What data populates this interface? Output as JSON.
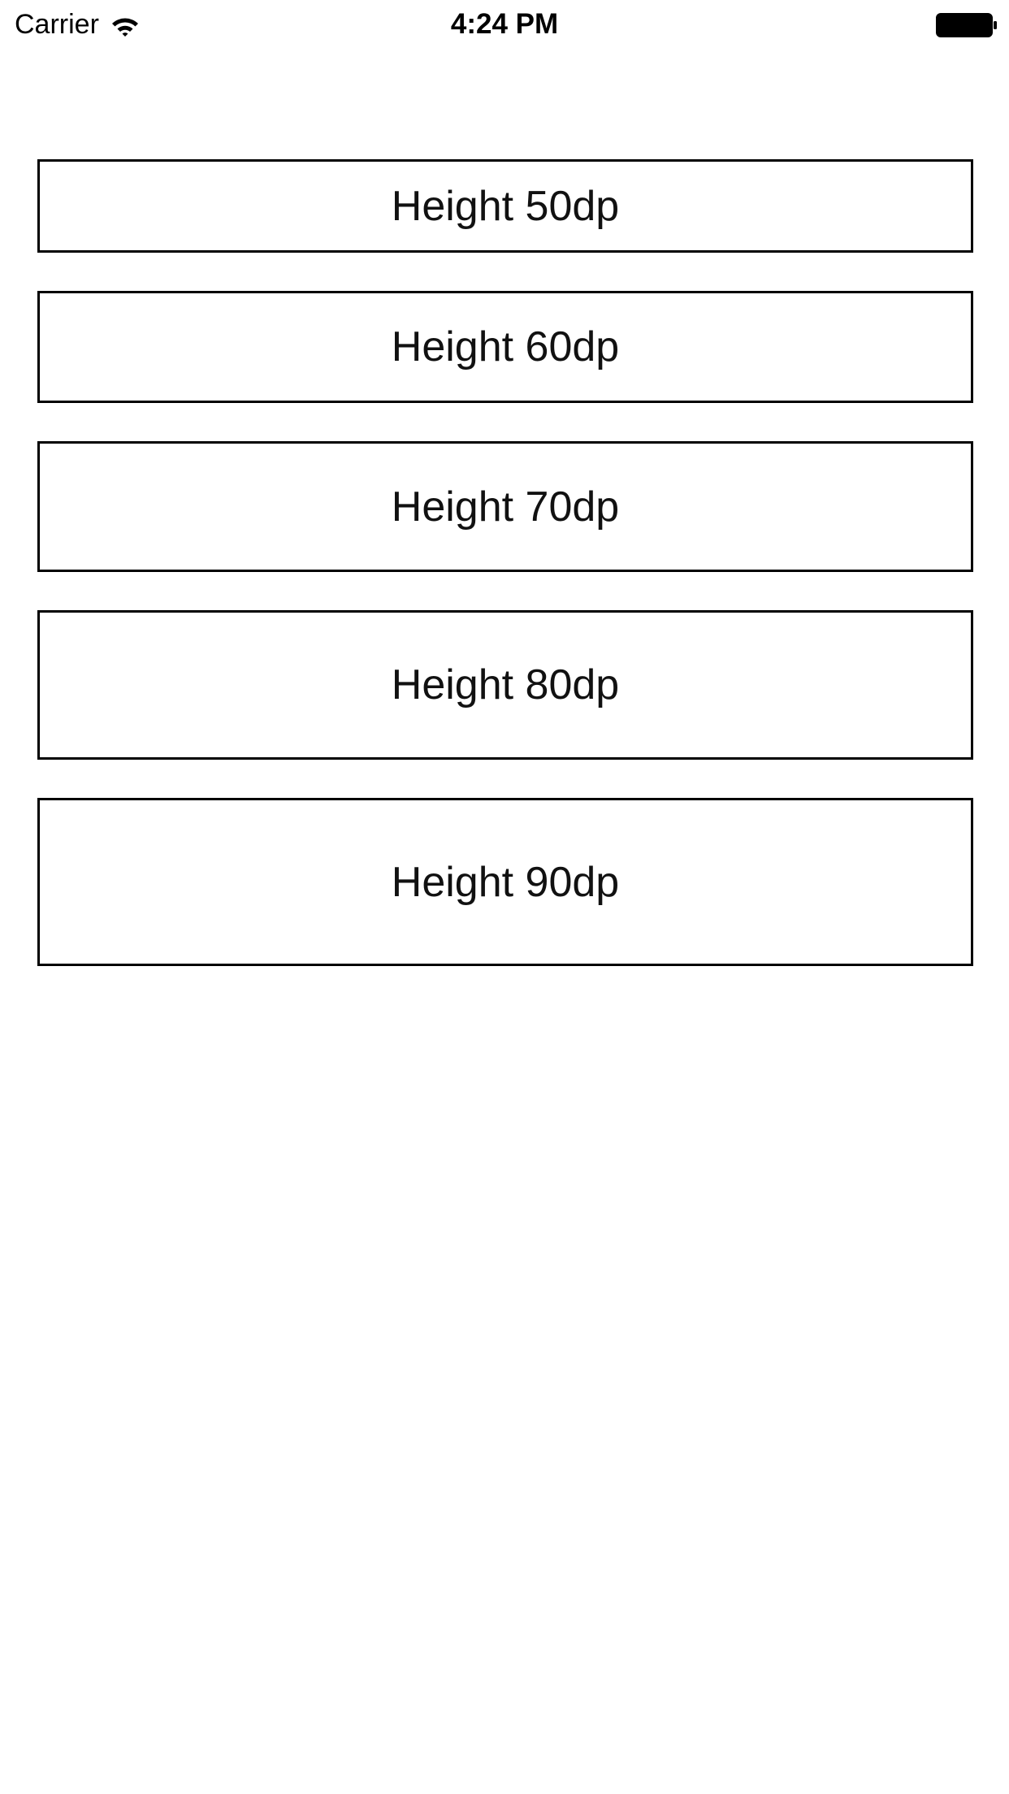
{
  "status_bar": {
    "carrier": "Carrier",
    "time": "4:24 PM",
    "icons": [
      "wifi-icon",
      "battery-icon"
    ]
  },
  "buttons": [
    {
      "label": "Height 50dp"
    },
    {
      "label": "Height 60dp"
    },
    {
      "label": "Height 70dp"
    },
    {
      "label": "Height 80dp"
    },
    {
      "label": "Height 90dp"
    }
  ],
  "colors": {
    "background": "#ffffff",
    "border": "#000000",
    "text": "#111111"
  }
}
